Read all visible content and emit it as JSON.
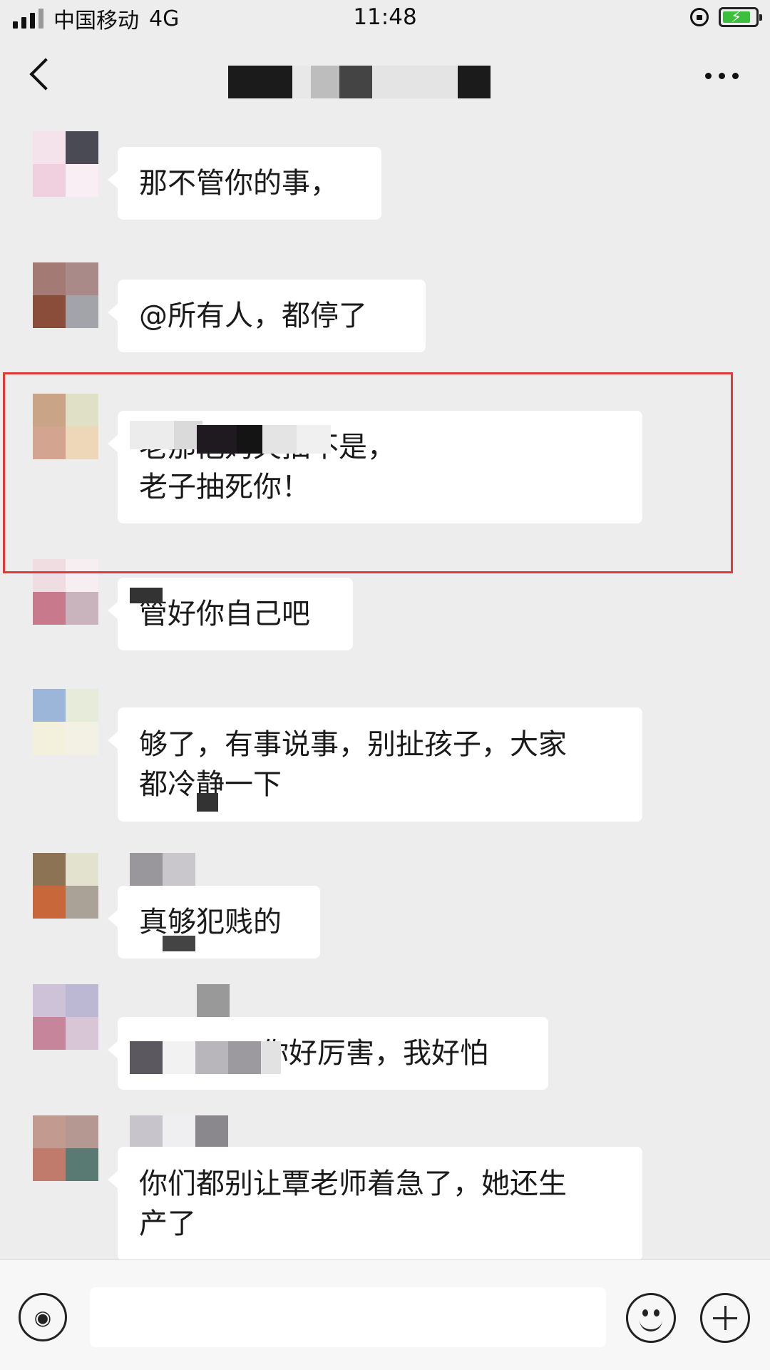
{
  "status_bar": {
    "carrier": "中国移动",
    "network": "4G",
    "time": "11:48"
  },
  "nav": {
    "back_icon": "chevron-left-icon",
    "more_icon": "ellipsis-icon"
  },
  "messages": [
    {
      "text": "那不管你的事，"
    },
    {
      "text": "@所有人，都停了"
    },
    {
      "text": "老那他妈欠抽不是，\n老子抽死你！"
    },
    {
      "text": "管好你自己吧"
    },
    {
      "text": "够了，有事说事，别扯孩子，大家\n都冷静一下"
    },
    {
      "text": "真够犯贱的"
    },
    {
      "text": "你好厉害，我好怕"
    },
    {
      "text": "你们都别让覃老师着急了，她还生\n产了"
    }
  ],
  "highlight_color": "#e13838",
  "input_bar": {
    "voice_icon": "voice-icon",
    "emoji_icon": "emoji-icon",
    "plus_icon": "plus-icon"
  }
}
